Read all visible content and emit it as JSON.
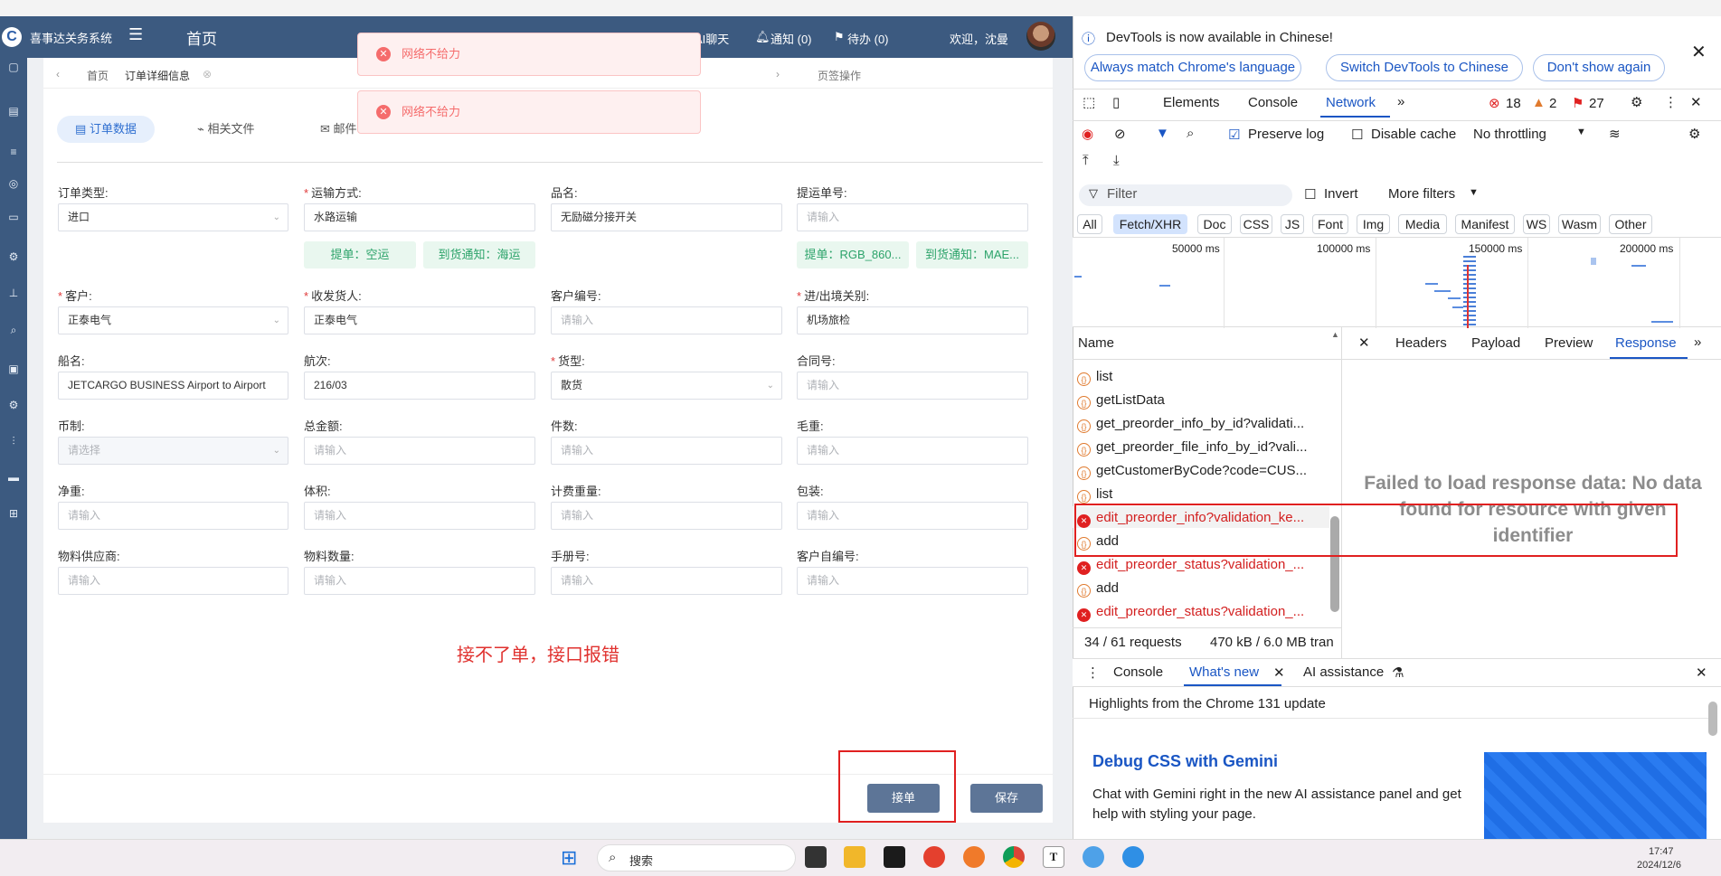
{
  "app": {
    "title": "喜事达关务系统",
    "home": "首页",
    "ai_chat": "AI聊天",
    "notify": "通知 (0)",
    "todo": "待办 (0)",
    "welcome": "欢迎，沈曼"
  },
  "tabs": {
    "home": "首页",
    "detail": "订单详细信息",
    "page_ops": "页签操作"
  },
  "subtabs": {
    "order_data": "订单数据",
    "files": "相关文件",
    "mail": "邮件"
  },
  "toasts": [
    "网络不给力",
    "网络不给力"
  ],
  "form": {
    "order_type": {
      "label": "订单类型:",
      "value": "进口"
    },
    "transport": {
      "label": "运输方式:",
      "value": "水路运输"
    },
    "product": {
      "label": "品名:",
      "value": "无励磁分接开关"
    },
    "bill_no": {
      "label": "提运单号:",
      "placeholder": "请输入"
    },
    "tag1": "提单：空运",
    "tag2": "到货通知：海运",
    "tag3": "提单：RGB_860...",
    "tag4": "到货通知：MAE...",
    "customer": {
      "label": "客户:",
      "value": "正泰电气"
    },
    "consignee": {
      "label": "收发货人:",
      "value": "正泰电气"
    },
    "customer_no": {
      "label": "客户编号:",
      "placeholder": "请输入"
    },
    "entry_exit": {
      "label": "进/出境关别:",
      "value": "机场旅检"
    },
    "ship": {
      "label": "船名:",
      "value": "JETCARGO BUSINESS Airport to Airport"
    },
    "voyage": {
      "label": "航次:",
      "value": "216/03"
    },
    "cargo_type": {
      "label": "货型:",
      "value": "散货"
    },
    "contract": {
      "label": "合同号:",
      "placeholder": "请输入"
    },
    "currency": {
      "label": "币制:",
      "placeholder": "请选择"
    },
    "total": {
      "label": "总金额:",
      "placeholder": "请输入"
    },
    "pieces": {
      "label": "件数:",
      "placeholder": "请输入"
    },
    "gross": {
      "label": "毛重:",
      "placeholder": "请输入"
    },
    "net": {
      "label": "净重:",
      "placeholder": "请输入"
    },
    "volume": {
      "label": "体积:",
      "placeholder": "请输入"
    },
    "charge_wt": {
      "label": "计费重量:",
      "placeholder": "请输入"
    },
    "pack": {
      "label": "包装:",
      "placeholder": "请输入"
    },
    "supplier": {
      "label": "物料供应商:",
      "placeholder": "请输入"
    },
    "qty": {
      "label": "物料数量:",
      "placeholder": "请输入"
    },
    "manual": {
      "label": "手册号:",
      "placeholder": "请输入"
    },
    "self_no": {
      "label": "客户自编号:",
      "placeholder": "请输入"
    }
  },
  "note": "接不了单，接口报错",
  "buttons": {
    "accept": "接单",
    "save": "保存"
  },
  "devtools": {
    "banner": "DevTools is now available in Chinese!",
    "btn_match": "Always match Chrome's language",
    "btn_switch": "Switch DevTools to Chinese",
    "btn_dont": "Don't show again",
    "tabs": [
      "Elements",
      "Console",
      "Network"
    ],
    "err_count": "18",
    "warn_count": "2",
    "info_count": "27",
    "preserve_log": "Preserve log",
    "disable_cache": "Disable cache",
    "throttling": "No throttling",
    "filter": "Filter",
    "invert": "Invert",
    "more_filters": "More filters",
    "chips": [
      "All",
      "Fetch/XHR",
      "Doc",
      "CSS",
      "JS",
      "Font",
      "Img",
      "Media",
      "Manifest",
      "WS",
      "Wasm",
      "Other"
    ],
    "ticks": [
      "50000 ms",
      "100000 ms",
      "150000 ms",
      "200000 ms"
    ],
    "name_header": "Name",
    "requests": [
      {
        "name": "list",
        "error": false
      },
      {
        "name": "getListData",
        "error": false
      },
      {
        "name": "get_preorder_info_by_id?validati...",
        "error": false
      },
      {
        "name": "get_preorder_file_info_by_id?vali...",
        "error": false
      },
      {
        "name": "getCustomerByCode?code=CUS...",
        "error": false
      },
      {
        "name": "list",
        "error": false
      },
      {
        "name": "edit_preorder_info?validation_ke...",
        "error": true
      },
      {
        "name": "add",
        "error": false
      },
      {
        "name": "edit_preorder_status?validation_...",
        "error": true
      },
      {
        "name": "add",
        "error": false
      },
      {
        "name": "edit_preorder_status?validation_...",
        "error": true
      }
    ],
    "detail_tabs": [
      "Headers",
      "Payload",
      "Preview",
      "Response"
    ],
    "fail_msg": "Failed to load response data: No data found for resource with given identifier",
    "status": "34 / 61 requests",
    "transfer": "470 kB / 6.0 MB tran",
    "drawer_tabs": [
      "Console",
      "What's new",
      "AI assistance"
    ],
    "highlights": "Highlights from the Chrome 131 update",
    "news_title": "Debug CSS with Gemini",
    "news_body": "Chat with Gemini right in the new AI assistance panel and get help with styling your page."
  },
  "taskbar": {
    "search": "搜索",
    "time": "17:47",
    "date": "2024/12/6"
  }
}
